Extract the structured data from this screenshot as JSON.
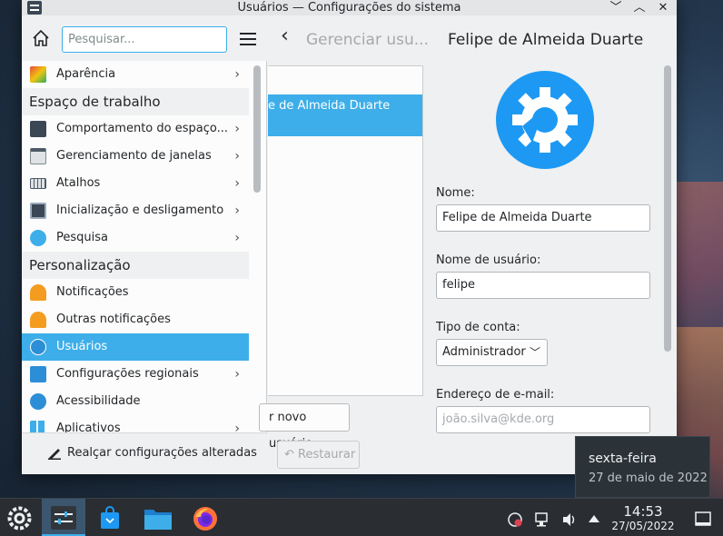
{
  "window": {
    "title": "Usuários — Configurações do sistema",
    "controls": [
      "﹀",
      "︿",
      "✕"
    ]
  },
  "sidebar": {
    "search_placeholder": "Pesquisar...",
    "items": [
      {
        "label": "Aparência",
        "icon": "appearance-icon",
        "chevron": "›"
      },
      {
        "group": "Espaço de trabalho"
      },
      {
        "label": "Comportamento do espaço...",
        "icon": "workspace-behavior-icon",
        "chevron": "›"
      },
      {
        "label": "Gerenciamento de janelas",
        "icon": "window-management-icon",
        "chevron": "›"
      },
      {
        "label": "Atalhos",
        "icon": "keyboard-icon",
        "chevron": "›"
      },
      {
        "label": "Inicialização e desligamento",
        "icon": "startup-icon",
        "chevron": "›"
      },
      {
        "label": "Pesquisa",
        "icon": "search-icon",
        "chevron": "›"
      },
      {
        "group": "Personalização"
      },
      {
        "label": "Notificações",
        "icon": "bell-icon"
      },
      {
        "label": "Outras notificações",
        "icon": "bell-icon"
      },
      {
        "label": "Usuários",
        "icon": "users-icon",
        "selected": true
      },
      {
        "label": "Configurações regionais",
        "icon": "regional-icon",
        "chevron": "›"
      },
      {
        "label": "Acessibilidade",
        "icon": "accessibility-icon"
      },
      {
        "label": "Aplicativos",
        "icon": "applications-icon",
        "chevron": "›"
      }
    ],
    "footer_button": "Realçar configurações alteradas"
  },
  "header": {
    "back": "‹",
    "breadcrumb": "Gerenciar usu...",
    "title": "Felipe de Almeida Duarte"
  },
  "user_list": {
    "selected_user": "e de Almeida Duarte",
    "new_user_button": "r novo usuário",
    "restore_button": "Restaurar",
    "restore_icon": "↶"
  },
  "form": {
    "name_label": "Nome:",
    "name_value": "Felipe de Almeida Duarte",
    "username_label": "Nome de usuário:",
    "username_value": "felipe",
    "account_type_label": "Tipo de conta:",
    "account_type_value": "Administrador",
    "email_label": "Endereço de e-mail:",
    "email_placeholder": "joão.silva@kde.org"
  },
  "tooltip": {
    "weekday": "sexta-feira",
    "date": "27 de maio de 2022"
  },
  "taskbar": {
    "time": "14:53",
    "date": "27/05/2022"
  },
  "colors": {
    "accent": "#3daee9",
    "window_bg": "#eff0f1",
    "taskbar_bg": "#2a2e32"
  }
}
